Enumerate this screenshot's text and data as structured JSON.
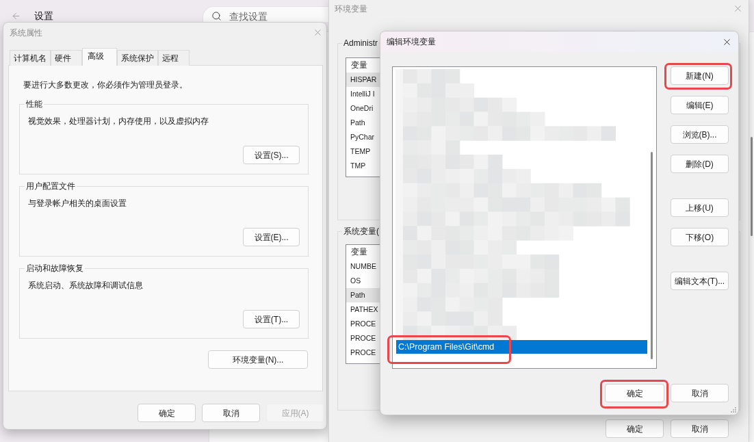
{
  "settings": {
    "title": "设置",
    "search": {
      "placeholder": "查找设置"
    }
  },
  "system_properties": {
    "title": "系统属性",
    "tabs": [
      {
        "label": "计算机名",
        "selected": false
      },
      {
        "label": "硬件",
        "selected": false
      },
      {
        "label": "高级",
        "selected": true
      },
      {
        "label": "系统保护",
        "selected": false
      },
      {
        "label": "远程",
        "selected": false
      }
    ],
    "notice": "要进行大多数更改，你必须作为管理员登录。",
    "groups": [
      {
        "title": "性能",
        "description": "视觉效果，处理器计划，内存使用，以及虚拟内存",
        "button": "设置(S)..."
      },
      {
        "title": "用户配置文件",
        "description": "与登录帐户相关的桌面设置",
        "button": "设置(E)..."
      },
      {
        "title": "启动和故障恢复",
        "description": "系统启动、系统故障和调试信息",
        "button": "设置(T)..."
      }
    ],
    "environment_button": "环境变量(N)...",
    "buttons": [
      {
        "label": "确定",
        "disabled": false
      },
      {
        "label": "取消",
        "disabled": false
      },
      {
        "label": "应用(A)",
        "disabled": true
      }
    ]
  },
  "environment_variables": {
    "title": "环境变量",
    "user_variables": {
      "title": "Administr",
      "header": "变量",
      "rows": [
        {
          "name": "HISPAR",
          "selected": true
        },
        {
          "name": "IntelliJ I",
          "selected": false
        },
        {
          "name": "OneDri",
          "selected": false
        },
        {
          "name": "Path",
          "selected": false
        },
        {
          "name": "PyChar",
          "selected": false
        },
        {
          "name": "TEMP",
          "selected": false
        },
        {
          "name": "TMP",
          "selected": false
        }
      ]
    },
    "system_variables": {
      "title": "系统变量(",
      "header": "变量",
      "rows": [
        {
          "name": "NUMBE",
          "selected": false
        },
        {
          "name": "OS",
          "selected": false
        },
        {
          "name": "Path",
          "selected": true
        },
        {
          "name": "PATHEX",
          "selected": false
        },
        {
          "name": "PROCE",
          "selected": false
        },
        {
          "name": "PROCE",
          "selected": false
        },
        {
          "name": "PROCE",
          "selected": false
        }
      ]
    },
    "buttons": [
      "确定",
      "取消"
    ]
  },
  "edit_dialog": {
    "title": "编辑环境变量",
    "entries": [
      {
        "value": "C:\\Program Files\\Git\\cmd",
        "selected": true,
        "highlighted": true
      }
    ],
    "button_groups": [
      [
        {
          "label": "新建(N)",
          "highlighted": true
        },
        {
          "label": "编辑(E)",
          "highlighted": false
        },
        {
          "label": "浏览(B)...",
          "highlighted": false
        },
        {
          "label": "删除(D)",
          "highlighted": false
        }
      ],
      [
        {
          "label": "上移(U)",
          "highlighted": false
        },
        {
          "label": "下移(O)",
          "highlighted": false
        }
      ],
      [
        {
          "label": "编辑文本(T)...",
          "highlighted": false
        }
      ]
    ],
    "buttons": [
      {
        "label": "确定",
        "highlighted": true
      },
      {
        "label": "取消",
        "highlighted": false
      }
    ]
  }
}
